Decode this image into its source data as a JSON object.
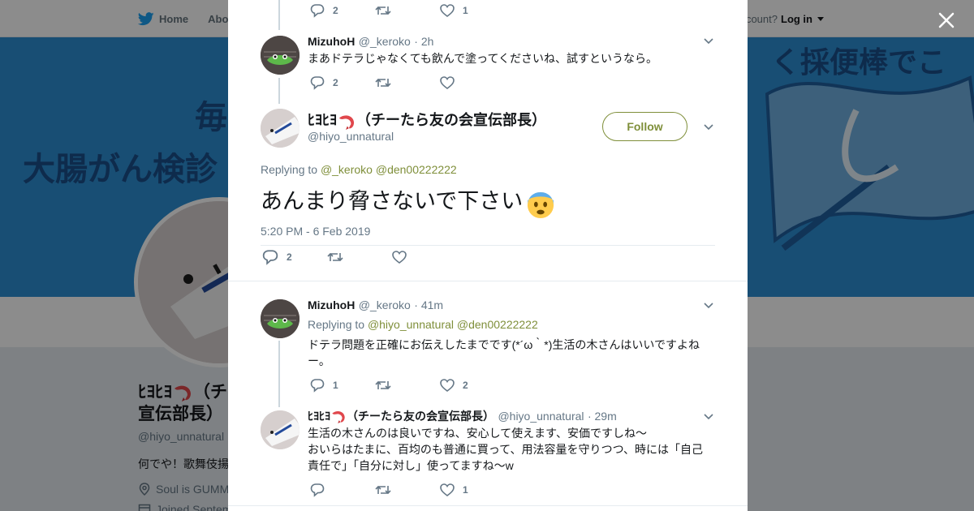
{
  "topbar": {
    "home_label": "Home",
    "about_label": "Abo",
    "account_prefix": "ccount?",
    "login_label": "Log in"
  },
  "banner": {
    "line1": "毎",
    "line2": "大腸がん検診",
    "line3": "く採便棒でこする"
  },
  "background_profile": {
    "name_line1": "ﾋﾖﾋﾖ",
    "name_paren": "（チー",
    "name_line2": "宣伝部長）",
    "handle": "@hiyo_unnatural",
    "bio": "何でや！歌舞伎揚",
    "location": "Soul is GUMM",
    "joined": "Joined Septem"
  },
  "thread": {
    "top_actions": {
      "reply_count": "2",
      "like_count": "1"
    },
    "reply1": {
      "name": "MizuhoH",
      "handle": "@_keroko",
      "time": "· 2h",
      "text": "まあドテラじゃなくても飲んで塗ってくださいね、試すというなら。",
      "reply_count": "2",
      "like_count": ""
    },
    "main": {
      "name": "ﾋﾖﾋﾖ",
      "name_suffix": "（チーたら友の会宣伝部長）",
      "handle": "@hiyo_unnatural",
      "follow_label": "Follow",
      "replying_prefix": "Replying to",
      "replying_user1": "@_keroko",
      "replying_user2": "@den00222222",
      "text": "あんまり脅さないで下さい",
      "date": "5:20 PM - 6 Feb 2019",
      "reply_count": "2"
    },
    "reply2": {
      "name": "MizuhoH",
      "handle": "@_keroko",
      "time": "· 41m",
      "replying_prefix": "Replying to",
      "replying_user1": "@hiyo_unnatural",
      "replying_user2": "@den00222222",
      "text_line1": "ドテラ問題を正確にお伝えしたまでです(*´ω｀*)生活の木さんはいいですよね",
      "text_line2": "ー。",
      "reply_count": "1",
      "like_count": "2"
    },
    "reply3": {
      "name": "ﾋﾖﾋﾖ",
      "name_suffix": "（チーたら友の会宣伝部長）",
      "handle": "@hiyo_unnatural",
      "time": "· 29m",
      "text_line1": "生活の木さんのは良いですね、安心して使えます、安価ですしね〜",
      "text_line2": "おいらはたまに、百均のも普通に買って、用法容量を守りつつ、時には「自己",
      "text_line3": "責任で」「自分に対し」使ってますね〜w",
      "reply_count": "",
      "like_count": "1"
    }
  },
  "colors": {
    "link": "#7f8f3a",
    "overlay": "rgba(0,0,0,0.45)",
    "banner": "#2d8fd3",
    "twitter_blue": "#1da1f2"
  }
}
